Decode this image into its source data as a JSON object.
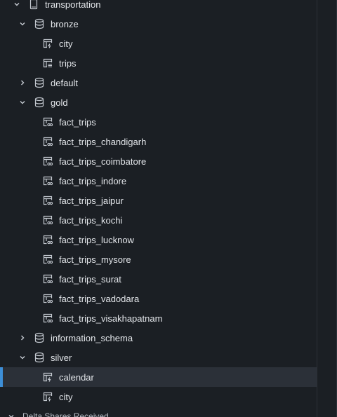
{
  "tree": {
    "catalog": {
      "label": "transportation",
      "icon": "catalog-icon"
    },
    "bronze": {
      "label": "bronze",
      "tables": [
        {
          "label": "city",
          "icon": "table-stream-icon"
        },
        {
          "label": "trips",
          "icon": "table-stream-icon"
        }
      ]
    },
    "default": {
      "label": "default"
    },
    "gold": {
      "label": "gold",
      "tables": [
        {
          "label": "fact_trips",
          "icon": "table-view-icon"
        },
        {
          "label": "fact_trips_chandigarh",
          "icon": "table-view-icon"
        },
        {
          "label": "fact_trips_coimbatore",
          "icon": "table-view-icon"
        },
        {
          "label": "fact_trips_indore",
          "icon": "table-view-icon"
        },
        {
          "label": "fact_trips_jaipur",
          "icon": "table-view-icon"
        },
        {
          "label": "fact_trips_kochi",
          "icon": "table-view-icon"
        },
        {
          "label": "fact_trips_lucknow",
          "icon": "table-view-icon"
        },
        {
          "label": "fact_trips_mysore",
          "icon": "table-view-icon"
        },
        {
          "label": "fact_trips_surat",
          "icon": "table-view-icon"
        },
        {
          "label": "fact_trips_vadodara",
          "icon": "table-view-icon"
        },
        {
          "label": "fact_trips_visakhapatnam",
          "icon": "table-view-icon"
        }
      ]
    },
    "information_schema": {
      "label": "information_schema"
    },
    "silver": {
      "label": "silver",
      "tables": [
        {
          "label": "calendar",
          "icon": "table-stream-icon",
          "selected": true
        },
        {
          "label": "city",
          "icon": "table-stream-icon"
        }
      ]
    },
    "delta_shares": {
      "label": "Delta Shares Received"
    }
  },
  "colors": {
    "background": "#1b1f24",
    "selected_row": "#2b3038",
    "selection_accent": "#3d8fd8",
    "text": "#e3e6ea"
  }
}
